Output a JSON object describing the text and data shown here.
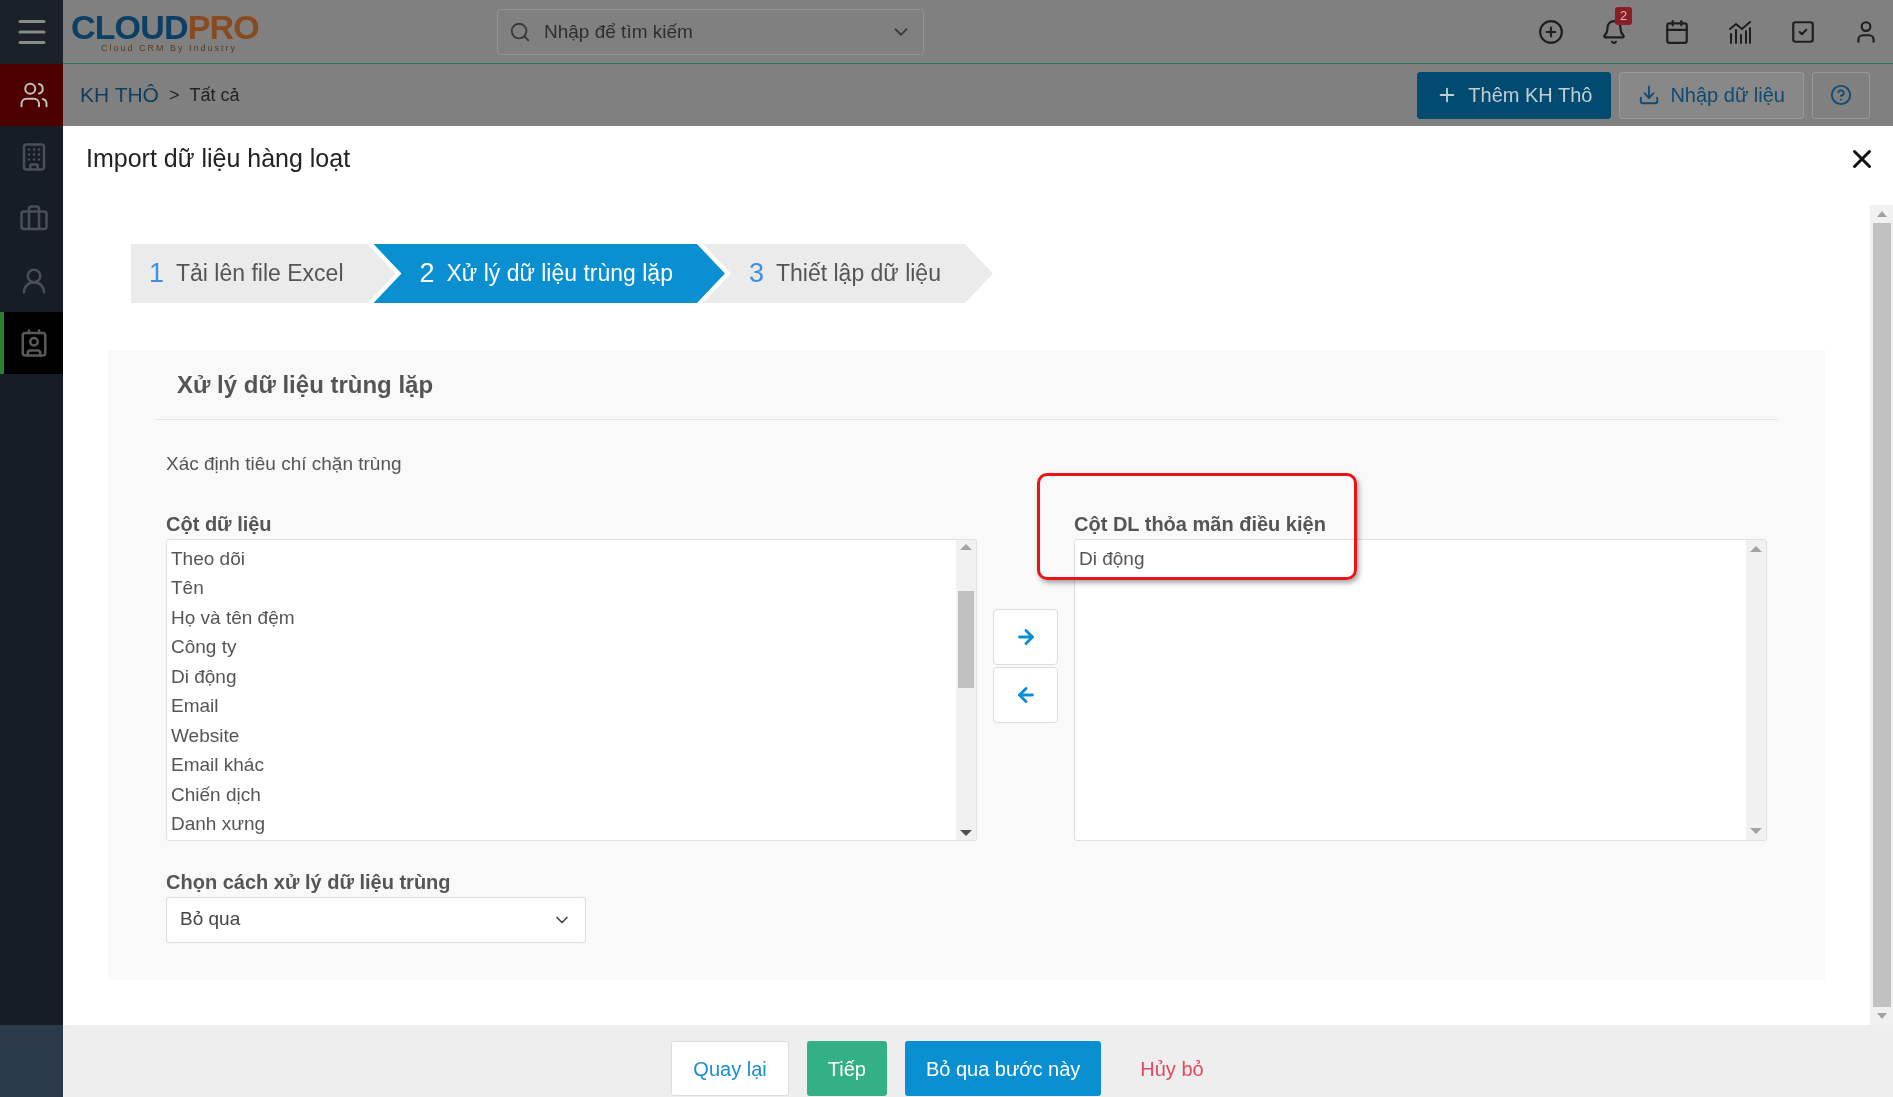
{
  "header": {
    "logo": {
      "main": "CLOUD",
      "accent": "PRO",
      "tagline": "Cloud CRM By Industry"
    },
    "search": {
      "placeholder": "Nhập để tìm kiếm"
    },
    "notification_count": "2"
  },
  "sidebar": {
    "items": [
      {
        "kind": "people",
        "highlight": true,
        "selected": false
      },
      {
        "kind": "building",
        "highlight": false,
        "selected": false
      },
      {
        "kind": "person-tie",
        "highlight": false,
        "selected": false
      },
      {
        "kind": "person",
        "highlight": false,
        "selected": false
      },
      {
        "kind": "contact",
        "highlight": false,
        "selected": true
      }
    ]
  },
  "breadcrumb": {
    "module": "KH THÔ",
    "separator": ">",
    "current": "Tất cả"
  },
  "actions": [
    {
      "label": "Thêm KH Thô",
      "kind": "primary"
    },
    {
      "label": "Nhập dữ liệu",
      "kind": "import"
    }
  ],
  "modal": {
    "title": "Import dữ liệu hàng loạt",
    "steps": [
      {
        "number": "1",
        "label": "Tải lên file Excel",
        "selected": false
      },
      {
        "number": "2",
        "label": "Xử lý dữ liệu trùng lặp",
        "selected": true
      },
      {
        "number": "3",
        "label": "Thiết lập dữ liệu",
        "selected": false
      }
    ],
    "section_title": "Xử lý dữ liệu trùng lặp",
    "criteria_label": "Xác định tiêu chí chặn trùng",
    "source": {
      "label": "Cột dữ liệu",
      "items": [
        "Theo dõi",
        "Tên",
        "Họ và tên đệm",
        "Công ty",
        "Di động",
        "Email",
        "Website",
        "Email khác",
        "Chiến dịch",
        "Danh xưng"
      ]
    },
    "target": {
      "label": "Cột DL thỏa mãn điều kiện",
      "items": [
        "Di động"
      ],
      "highlighted": true
    },
    "handling": {
      "label": "Chọn cách xử lý dữ liệu trùng",
      "value": "Bỏ qua"
    }
  },
  "footer": {
    "buttons": [
      {
        "label": "Quay lại",
        "kind": "outline"
      },
      {
        "label": "Tiếp",
        "kind": "success"
      },
      {
        "label": "Bỏ qua bước này",
        "kind": "primary"
      },
      {
        "label": "Hủy bỏ",
        "kind": "danger"
      }
    ]
  }
}
